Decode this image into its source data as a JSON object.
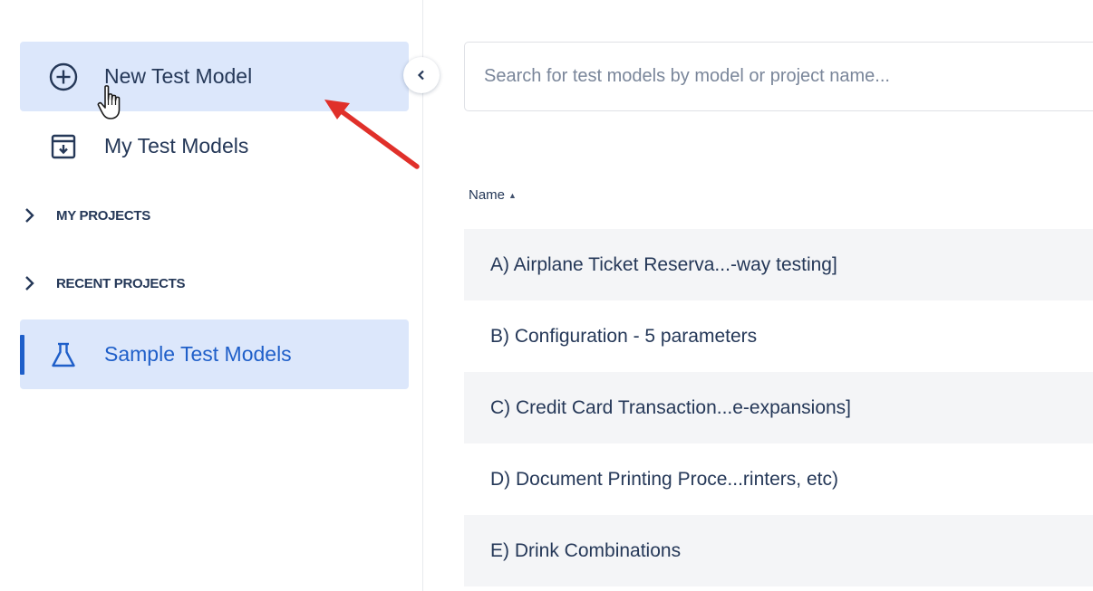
{
  "sidebar": {
    "new_model_label": "New Test Model",
    "my_models_label": "My Test Models",
    "sections": {
      "my_projects": "MY PROJECTS",
      "recent_projects": "RECENT PROJECTS"
    },
    "sample_models_label": "Sample Test Models"
  },
  "search": {
    "placeholder": "Search for test models by model or project name...",
    "value": ""
  },
  "table": {
    "column_name": "Name",
    "sort_indicator": "▲",
    "rows": [
      "A) Airplane Ticket Reserva...-way testing]",
      "B) Configuration - 5 parameters",
      "C) Credit Card Transaction...e-expansions]",
      "D) Document Printing Proce...rinters, etc)",
      "E) Drink Combinations"
    ]
  },
  "icons": {
    "new": "plus-circle-icon",
    "my_models": "archive-box-icon",
    "section_chevron": "chevron-right-icon",
    "sample": "flask-icon",
    "collapse": "chevron-left-icon"
  },
  "colors": {
    "accent": "#1f5fc9",
    "active_background": "#dce7fb",
    "annotation_arrow": "#e0302a"
  }
}
